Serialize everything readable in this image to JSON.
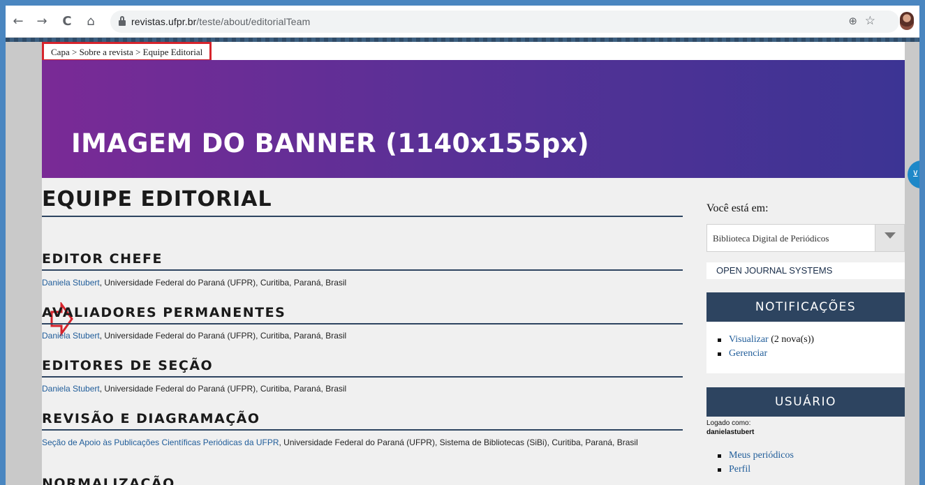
{
  "browser": {
    "back_icon": "←",
    "forward_icon": "→",
    "reload_icon": "C",
    "home_icon": "⌂",
    "url_host": "revistas.ufpr.br",
    "url_path": "/teste/about/editorialTeam",
    "zoom_icon": "⊕",
    "star_icon": "☆"
  },
  "breadcrumb": {
    "items": [
      "Capa",
      "Sobre a revista",
      "Equipe Editorial"
    ],
    "sep": " > "
  },
  "banner": {
    "text": "IMAGEM DO BANNER (1140x155px)"
  },
  "side_tab": {
    "icon": "⊻"
  },
  "main": {
    "title": "EQUIPE EDITORIAL",
    "sections": [
      {
        "heading": "EDITOR CHEFE",
        "link": "Daniela Stubert",
        "text": ", Universidade Federal do Paraná (UFPR), Curitiba, Paraná, Brasil"
      },
      {
        "heading": "AVALIADORES PERMANENTES",
        "link": "Daniela Stubert",
        "text": ", Universidade Federal do Paraná (UFPR), Curitiba, Paraná, Brasil"
      },
      {
        "heading": "EDITORES DE SEÇÃO",
        "link": "Daniela Stubert",
        "text": ", Universidade Federal do Paraná (UFPR), Curitiba, Paraná, Brasil"
      },
      {
        "heading": "REVISÃO E DIAGRAMAÇÃO",
        "link": "Seção de Apoio às Publicações Científicas Periódicas da UFPR",
        "text": ", Universidade Federal do Paraná (UFPR), Sistema de Bibliotecas (SiBi), Curitiba, Paraná, Brasil"
      },
      {
        "heading": "NORMALIZAÇÃO"
      }
    ]
  },
  "sidebar": {
    "you_are_label": "Você está em:",
    "journal_select_value": "Biblioteca Digital de Periódicos",
    "ojs_link": "OPEN JOURNAL SYSTEMS",
    "notifications": {
      "title": "NOTIFICAÇÕES",
      "view_link": "Visualizar",
      "view_count": "(2 nova(s))",
      "manage_link": "Gerenciar"
    },
    "user": {
      "title": "USUÁRIO",
      "logged_as": "Logado como:",
      "username": "danielastubert",
      "my_journals": "Meus periódicos",
      "profile": "Perfil"
    }
  },
  "colors": {
    "frame": "#4a86c0",
    "heading_rule": "#2d4460",
    "link": "#1f5c99",
    "highlight_red": "#d6242c"
  }
}
